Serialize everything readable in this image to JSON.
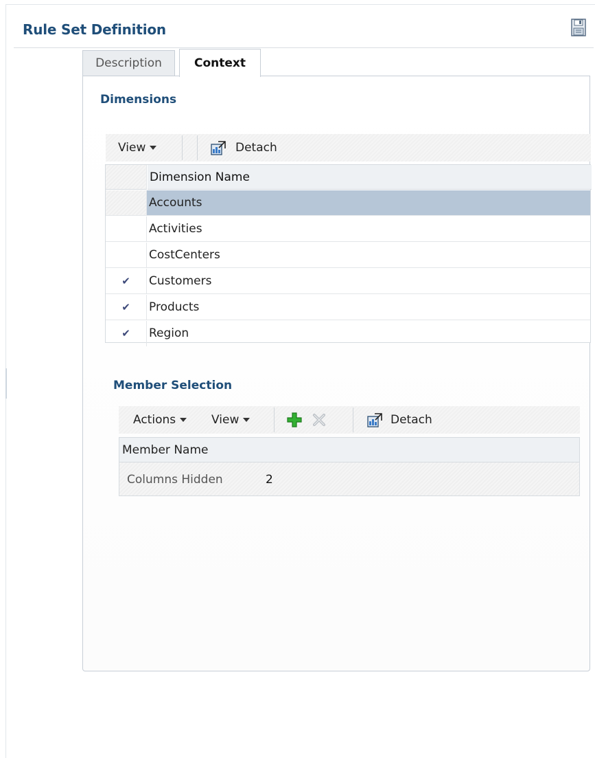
{
  "header": {
    "title": "Rule Set Definition"
  },
  "tabs": [
    {
      "label": "Description",
      "active": false
    },
    {
      "label": "Context",
      "active": true
    }
  ],
  "dimensions": {
    "title": "Dimensions",
    "toolbar": {
      "view_label": "View",
      "detach_label": "Detach"
    },
    "column_header": "Dimension Name",
    "rows": [
      {
        "name": "Accounts",
        "checked": false,
        "selected": true
      },
      {
        "name": "Activities",
        "checked": false,
        "selected": false
      },
      {
        "name": "CostCenters",
        "checked": false,
        "selected": false
      },
      {
        "name": "Customers",
        "checked": true,
        "selected": false
      },
      {
        "name": "Products",
        "checked": true,
        "selected": false
      },
      {
        "name": "Region",
        "checked": true,
        "selected": false
      }
    ],
    "check_glyph": "✔"
  },
  "member_selection": {
    "title": "Member Selection",
    "toolbar": {
      "actions_label": "Actions",
      "view_label": "View",
      "detach_label": "Detach"
    },
    "column_header": "Member Name",
    "columns_hidden_label": "Columns Hidden",
    "columns_hidden_count": "2"
  },
  "colors": {
    "title": "#1f4e79",
    "selected_row": "#b6c6d7",
    "add_icon": "#2e9e2e"
  }
}
